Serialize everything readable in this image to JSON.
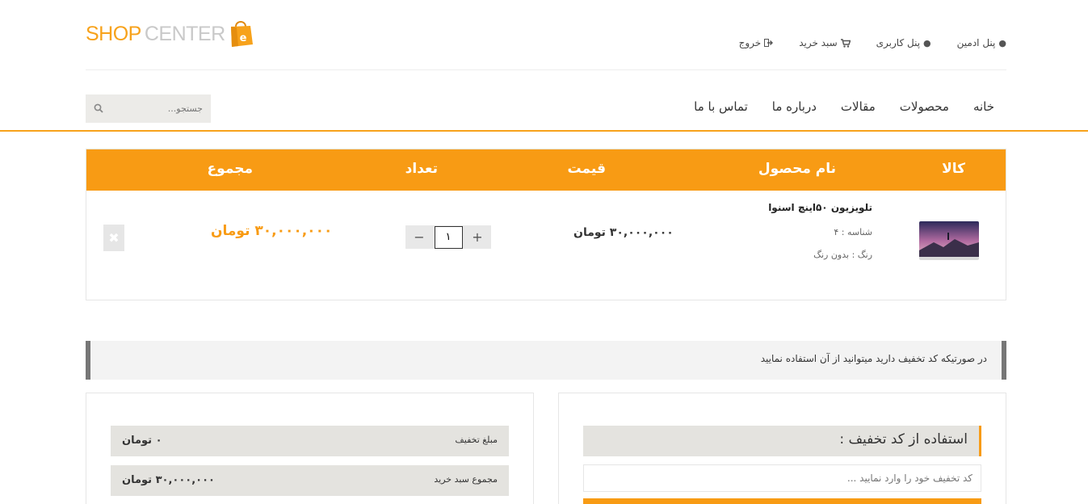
{
  "logo": {
    "shop": "SHOP",
    "center": "CENTER",
    "badge": "e"
  },
  "user_links": [
    {
      "label": "پنل ادمین",
      "icon": "user-icon"
    },
    {
      "label": "پنل کاربری",
      "icon": "user-icon"
    },
    {
      "label": "سبد خرید",
      "icon": "cart-icon"
    },
    {
      "label": "خروج",
      "icon": "sign-out-icon"
    }
  ],
  "menu": [
    "خانه",
    "محصولات",
    "مقالات",
    "درباره ما",
    "تماس با ما"
  ],
  "search": {
    "placeholder": "جستجو..."
  },
  "cart": {
    "headers": {
      "item": "کالا",
      "name": "نام محصول",
      "price": "قیمت",
      "qty": "تعداد",
      "total": "مجموع"
    },
    "row": {
      "name": "تلویزیون ۵۰اینچ اسنوا",
      "id": "شناسه : ۴",
      "color": "رنگ : بدون رنگ",
      "price": "۳۰,۰۰۰,۰۰۰ تومان",
      "qty": "۱",
      "plus": "+",
      "minus": "−",
      "total": "۳۰,۰۰۰,۰۰۰ تومان",
      "remove": "✖"
    }
  },
  "notice": "در صورتیکه کد تخفیف دارید میتوانید از آن استفاده نمایید",
  "summary": {
    "discount_label": "مبلغ تخفیف",
    "discount_value": "۰ تومان",
    "subtotal_label": "مجموع سبد خرید",
    "subtotal_value": "۳۰,۰۰۰,۰۰۰ تومان"
  },
  "coupon": {
    "title": "استفاده از کد تخفیف :",
    "placeholder": "کد تخفیف خود را وارد نمایید ..."
  },
  "colors": {
    "accent": "#f89b14",
    "logo_gray": "#c9c9c9"
  }
}
